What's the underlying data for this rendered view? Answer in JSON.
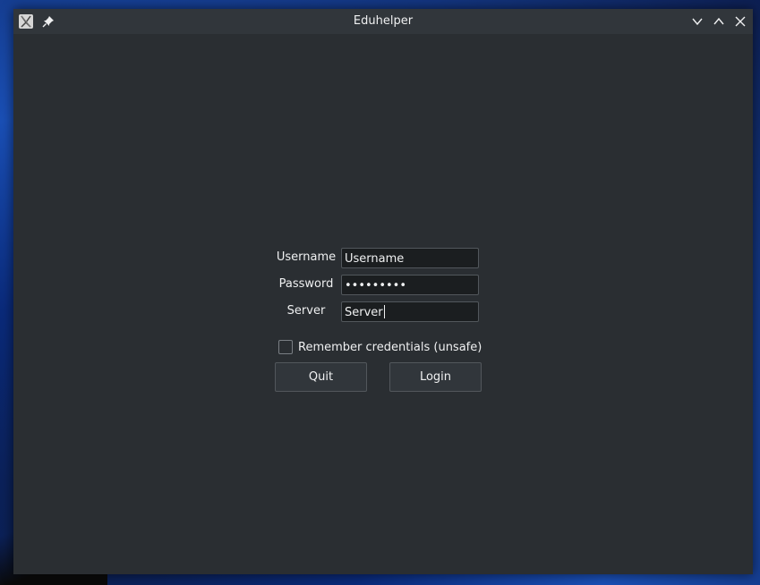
{
  "window": {
    "title": "Eduhelper"
  },
  "form": {
    "username": {
      "label": "Username",
      "value": "Username"
    },
    "password": {
      "label": "Password",
      "value": "•••••••••"
    },
    "server": {
      "label": "Server",
      "value": "Server"
    },
    "remember": {
      "label": "Remember credentials (unsafe)",
      "checked": false
    },
    "quit_label": "Quit",
    "login_label": "Login"
  },
  "colors": {
    "window_bg": "#2a2e32",
    "titlebar_bg": "#31363b",
    "field_bg": "#1b1e20",
    "text": "#eff0f1"
  },
  "icons": {
    "app": "app-icon",
    "pin": "pin-icon",
    "minimize": "chevron-down-icon",
    "maximize": "chevron-up-icon",
    "close": "close-icon"
  }
}
